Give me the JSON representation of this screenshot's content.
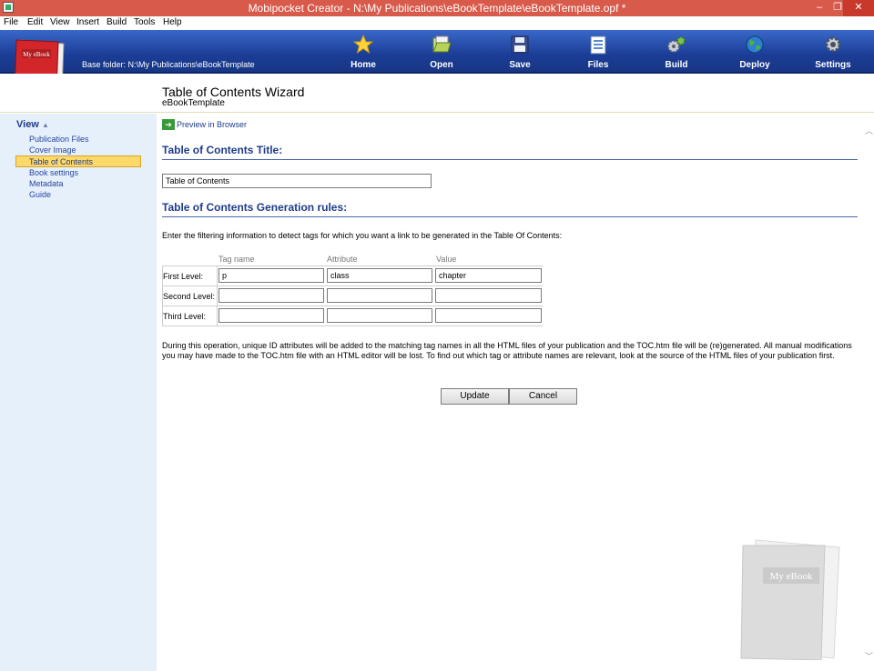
{
  "window": {
    "title": "Mobipocket Creator - N:\\My Publications\\eBookTemplate\\eBookTemplate.opf *",
    "minimize": "–",
    "restore": "❐",
    "close": "✕"
  },
  "menu": [
    "File",
    "Edit",
    "View",
    "Insert",
    "Build",
    "Tools",
    "Help"
  ],
  "banner": {
    "base_folder": "Base folder: N:\\My Publications\\eBookTemplate",
    "logo_text": "My eBook",
    "toolbar": [
      {
        "label": "Home",
        "icon": "star-icon"
      },
      {
        "label": "Open",
        "icon": "folder-icon"
      },
      {
        "label": "Save",
        "icon": "floppy-icon"
      },
      {
        "label": "Files",
        "icon": "files-icon"
      },
      {
        "label": "Build",
        "icon": "gears-icon"
      },
      {
        "label": "Deploy",
        "icon": "globe-icon"
      },
      {
        "label": "Settings",
        "icon": "settings-icon"
      }
    ]
  },
  "page": {
    "title": "Table of Contents Wizard",
    "subtitle": "eBookTemplate"
  },
  "sidebar": {
    "heading": "View",
    "items": [
      "Publication Files",
      "Cover Image",
      "Table of Contents",
      "Book settings",
      "Metadata",
      "Guide"
    ],
    "selected": "Table of Contents"
  },
  "main": {
    "preview_link": "Preview in Browser",
    "toc_title_heading": "Table of Contents Title:",
    "toc_title_value": "Table of Contents",
    "rules_heading": "Table of Contents Generation rules:",
    "instructions": "Enter the filtering information to detect tags for which you want a link to be generated in the Table Of Contents:",
    "columns": [
      "Tag name",
      "Attribute",
      "Value"
    ],
    "rows": [
      {
        "label": "First Level:",
        "tag": "p",
        "attribute": "class",
        "value": "chapter"
      },
      {
        "label": "Second Level:",
        "tag": "",
        "attribute": "",
        "value": ""
      },
      {
        "label": "Third Level:",
        "tag": "",
        "attribute": "",
        "value": ""
      }
    ],
    "note": "During this operation, unique ID attributes will be added to the matching tag names in all the HTML files of your publication and the TOC.htm file will be (re)generated. All manual modifications you may have made to the TOC.htm file with an HTML editor will be lost. To find out which tag or attribute names are relevant, look at the source of the HTML files of your publication first.",
    "update_button": "Update",
    "cancel_button": "Cancel"
  },
  "colors": {
    "banner": "#1b3d96",
    "titlebar": "#d85a4b",
    "sidebar": "#e6f0fb",
    "selected": "#ffd86a",
    "heading": "#1f3c8a"
  }
}
